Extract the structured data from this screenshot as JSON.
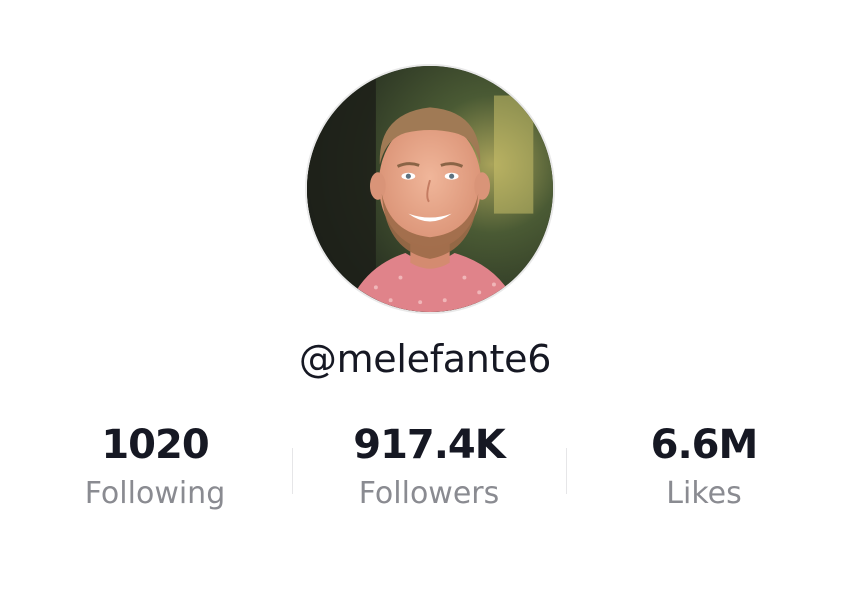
{
  "profile": {
    "username": "@melefante6",
    "avatar_alt": "Profile photo of a smiling man with short hair and beard wearing a pink shirt"
  },
  "stats": {
    "following": {
      "value": "1020",
      "label": "Following"
    },
    "followers": {
      "value": "917.4K",
      "label": "Followers"
    },
    "likes": {
      "value": "6.6M",
      "label": "Likes"
    }
  },
  "colors": {
    "text_primary": "#161823",
    "text_secondary": "#8a8b91",
    "divider": "#e6e6e8",
    "background": "#ffffff"
  }
}
